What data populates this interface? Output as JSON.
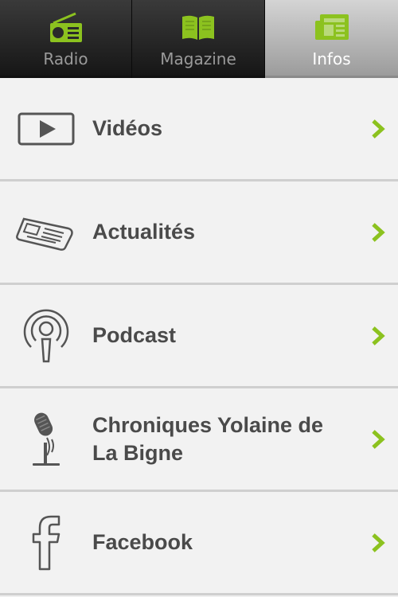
{
  "tabs": [
    {
      "label": "Radio",
      "icon": "radio-icon",
      "active": false
    },
    {
      "label": "Magazine",
      "icon": "book-icon",
      "active": false
    },
    {
      "label": "Infos",
      "icon": "newspaper-icon",
      "active": true
    }
  ],
  "items": [
    {
      "label": "Vidéos",
      "icon": "video-play-icon"
    },
    {
      "label": "Actualités",
      "icon": "newspaper-icon"
    },
    {
      "label": "Podcast",
      "icon": "podcast-icon"
    },
    {
      "label": "Chroniques Yolaine de La Bigne",
      "icon": "microphone-icon"
    },
    {
      "label": "Facebook",
      "icon": "facebook-icon"
    }
  ],
  "colors": {
    "accent": "#8cc21f",
    "text": "#4a4a4a",
    "icon": "#555555"
  }
}
